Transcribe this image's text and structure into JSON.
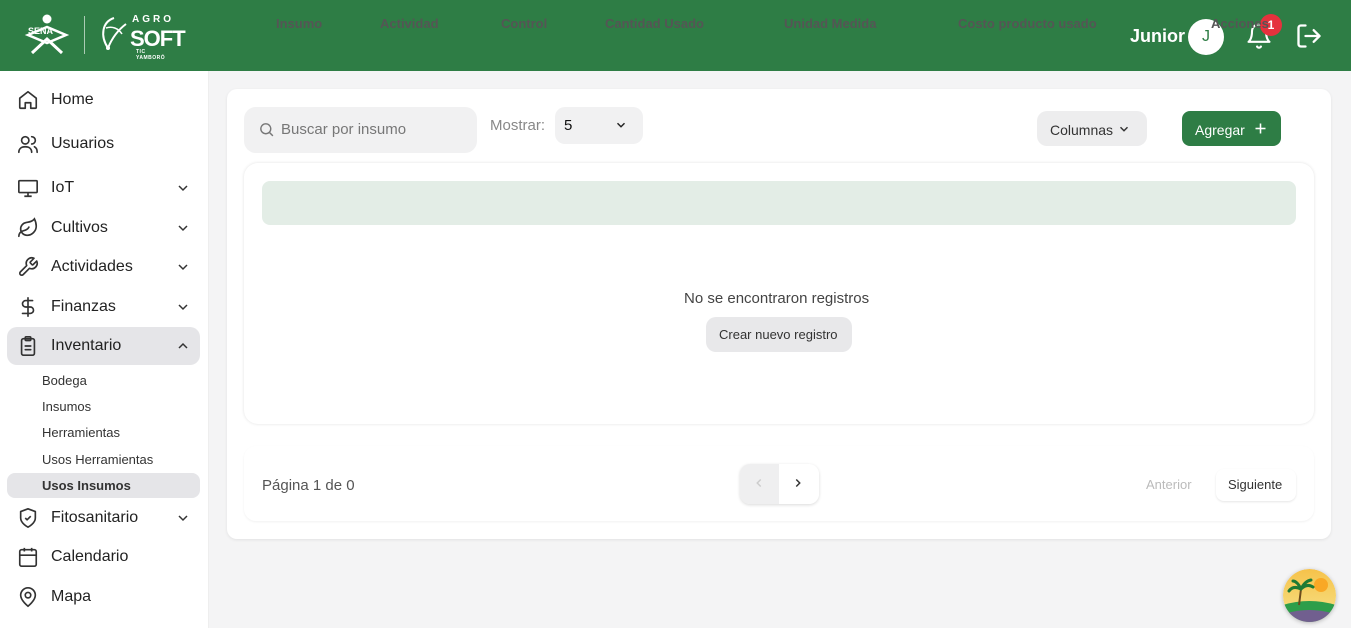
{
  "header": {
    "logo_sena": "SENA",
    "logo_agro": "AGRO",
    "logo_soft": "SOFT",
    "logo_sub": "TIC YAMBORÓ",
    "user_name": "Junior",
    "avatar_initial": "J",
    "notification_count": "1",
    "brand_color": "#2e7d45"
  },
  "sidebar": {
    "items": [
      {
        "label": "Home",
        "icon": "home-icon"
      },
      {
        "label": "Usuarios",
        "icon": "users-icon"
      },
      {
        "label": "IoT",
        "icon": "monitor-icon"
      },
      {
        "label": "Cultivos",
        "icon": "leaf-icon"
      },
      {
        "label": "Actividades",
        "icon": "wrench-icon"
      },
      {
        "label": "Finanzas",
        "icon": "dollar-icon"
      },
      {
        "label": "Inventario",
        "icon": "clipboard-icon"
      },
      {
        "label": "Fitosanitario",
        "icon": "shield-check-icon"
      },
      {
        "label": "Calendario",
        "icon": "calendar-icon"
      },
      {
        "label": "Mapa",
        "icon": "map-pin-icon"
      }
    ],
    "inventario_sub": [
      "Bodega",
      "Insumos",
      "Herramientas",
      "Usos Herramientas",
      "Usos Insumos"
    ],
    "active_sub": "Usos Insumos"
  },
  "toolbar": {
    "search_placeholder": "Buscar por insumo",
    "mostrar_label": "Mostrar:",
    "mostrar_value": "5",
    "columnas_label": "Columnas",
    "agregar_label": "Agregar"
  },
  "table": {
    "columns": [
      "Insumo",
      "Actividad",
      "Control",
      "Cantidad Usado",
      "Unidad Medida",
      "Costo producto usado",
      "Acciones"
    ],
    "empty_message": "No se encontraron registros",
    "create_label": "Crear nuevo registro"
  },
  "pagination": {
    "page_label": "Página 1 de 0",
    "anterior_label": "Anterior",
    "siguiente_label": "Siguiente"
  }
}
